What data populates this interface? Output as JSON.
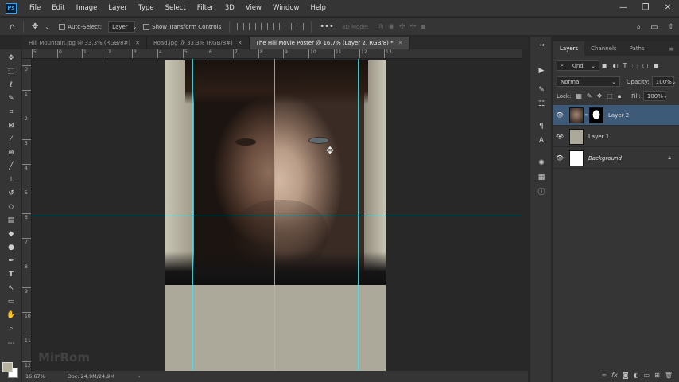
{
  "app": {
    "logo": "Ps"
  },
  "menu": [
    "File",
    "Edit",
    "Image",
    "Layer",
    "Type",
    "Select",
    "Filter",
    "3D",
    "View",
    "Window",
    "Help"
  ],
  "window_controls": [
    "—",
    "❐",
    "✕"
  ],
  "options": {
    "auto_select_label": "Auto-Select:",
    "auto_select_target": "Layer",
    "show_transform_label": "Show Transform Controls",
    "more": "•••",
    "mode_3d": "3D Mode:"
  },
  "tabs": [
    {
      "label": "Hill Mountain.jpg @ 33,3% (RGB/8#)",
      "close": "✕",
      "active": false
    },
    {
      "label": "Road.jpg @ 33,3% (RGB/8#)",
      "close": "✕",
      "active": false
    },
    {
      "label": "The Hill Movie Poster @ 16,7% (Layer 2, RGB/8) *",
      "close": "✕",
      "active": true
    }
  ],
  "ruler_top": [
    "5",
    "0",
    "1",
    "2",
    "3",
    "4",
    "5",
    "6",
    "7",
    "8",
    "9",
    "10",
    "11",
    "12",
    "13"
  ],
  "ruler_left": [
    "0",
    "1",
    "2",
    "3",
    "4",
    "5",
    "6",
    "7",
    "8",
    "9",
    "10",
    "11",
    "12"
  ],
  "canvas": {
    "watermark": "MirRom"
  },
  "status": {
    "zoom": "16,67%",
    "doc": "Doc: 24,9M/24,9M",
    "arrow": "›"
  },
  "layers_panel": {
    "tabs": [
      "Layers",
      "Channels",
      "Paths"
    ],
    "filter_kind": "Kind",
    "blend_mode": "Normal",
    "opacity_label": "Opacity:",
    "opacity_value": "100%",
    "lock_label": "Lock:",
    "fill_label": "Fill:",
    "fill_value": "100%",
    "layers": [
      {
        "name": "Layer 2",
        "selected": true,
        "thumb_color": "#6b5646"
      },
      {
        "name": "Layer 1",
        "selected": false,
        "thumb_color": "#ada99a"
      },
      {
        "name": "Background",
        "selected": false,
        "thumb_color": "#ffffff",
        "locked": true
      }
    ],
    "footer_icons": [
      "link-icon",
      "fx-icon",
      "mask-icon",
      "adjustment-icon",
      "group-icon",
      "new-layer-icon",
      "trash-icon"
    ]
  },
  "colors": {
    "foreground": "#b5b3a0",
    "background": "#ffffff",
    "guide": "#47e0e8",
    "accent": "#31a8ff"
  }
}
